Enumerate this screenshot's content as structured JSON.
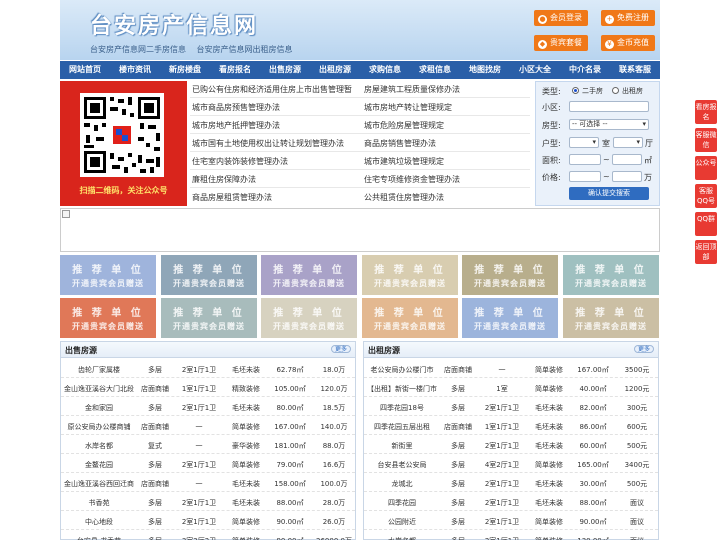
{
  "header": {
    "logo": "台安房产信息网",
    "slogans": [
      "台安房产信息网二手房信息",
      "台安房产信息网出租房信息"
    ],
    "buttons": {
      "login": "会员登录",
      "register": "免费注册",
      "vip": "贵宾套餐",
      "recharge": "金币充值"
    }
  },
  "nav": [
    "网站首页",
    "楼市资讯",
    "新房楼盘",
    "看房报名",
    "出售房源",
    "出租房源",
    "求购信息",
    "求租信息",
    "地图找房",
    "小区大全",
    "中介名录",
    "联系客服"
  ],
  "qr": {
    "caption": "扫描二维码，关注公众号"
  },
  "links_left": [
    "已购公有住房和经济适用住房上市出售管理暂",
    "城市商品房预售管理办法",
    "城市房地产抵押管理办法",
    "城市国有土地使用权出让转让规划管理办法",
    "住宅室内装饰装修管理办法",
    "廉租住房保障办法",
    "商品房屋租赁管理办法"
  ],
  "links_right": [
    "房屋建筑工程质量保修办法",
    "城市房地产转让管理规定",
    "城市危险房屋管理规定",
    "商品房销售管理办法",
    "城市建筑垃圾管理规定",
    "住宅专项维修资金管理办法",
    "公共租赁住房管理办法"
  ],
  "search": {
    "type_label": "类型:",
    "opt_sale": "二手房",
    "opt_rent": "出租房",
    "community_label": "小区:",
    "housetype_label": "房型:",
    "housetype_value": "-- 可选择 --",
    "layout_label": "户型:",
    "room_unit": "室",
    "hall_unit": "厅",
    "area_label": "面积:",
    "area_unit": "㎡",
    "price_label": "价格:",
    "price_unit": "万",
    "range_sep": "~",
    "submit": "确认提交搜索"
  },
  "recommend": {
    "title": "推 荐 单 位",
    "subtitle": "开通贵宾会员赠送",
    "colors": [
      "#9fb4dc",
      "#8fa6b8",
      "#a9a2c8",
      "#d8cdb0",
      "#b8ae8c",
      "#9fc0c0",
      "#e07858",
      "#a8bcbc",
      "#d7d2c0",
      "#e3b890",
      "#9cb4dc",
      "#cbbfa4"
    ]
  },
  "sale": {
    "title": "出售房源",
    "more": "更多",
    "rows": [
      [
        "齿轮厂家属楼",
        "多层",
        "2室1厅1卫",
        "毛坯未装",
        "62.78㎡",
        "18.0万"
      ],
      [
        "金山逸亚溪谷大门北段",
        "店面商铺",
        "1室1厅1卫",
        "精致装修",
        "105.00㎡",
        "120.0万"
      ],
      [
        "金和家园",
        "多层",
        "2室1厅1卫",
        "毛坯未装",
        "80.00㎡",
        "18.5万"
      ],
      [
        "原公安局办公楼商铺",
        "店面商铺",
        "一",
        "简单装修",
        "167.00㎡",
        "140.0万"
      ],
      [
        "水岸名都",
        "复式",
        "一",
        "豪华装修",
        "181.00㎡",
        "88.0万"
      ],
      [
        "金鳌花园",
        "多层",
        "2室1厅1卫",
        "简单装修",
        "79.00㎡",
        "16.6万"
      ],
      [
        "金山逸亚溪谷西回迁商",
        "店面商铺",
        "一",
        "毛坯未装",
        "158.00㎡",
        "100.0万"
      ],
      [
        "书香苑",
        "多层",
        "2室1厅1卫",
        "毛坯未装",
        "88.00㎡",
        "28.0万"
      ],
      [
        "中心地段",
        "多层",
        "2室1厅1卫",
        "简单装修",
        "90.00㎡",
        "26.0万"
      ],
      [
        "台安县 书香苑",
        "多层",
        "3室2厅2卫",
        "简单装修",
        "90.00㎡",
        "26000.0万"
      ]
    ]
  },
  "rent": {
    "title": "出租房源",
    "more": "更多",
    "rows": [
      [
        "老公安局办公楼门市",
        "店面商铺",
        "一",
        "简单装修",
        "167.00㎡",
        "3500元"
      ],
      [
        "【出租】新街一楼门市",
        "多层",
        "1室",
        "简单装修",
        "40.00㎡",
        "1200元"
      ],
      [
        "四季花园18号",
        "多层",
        "2室1厅1卫",
        "毛坯未装",
        "82.00㎡",
        "300元"
      ],
      [
        "四季花园五层出租",
        "店面商铺",
        "1室1厅1卫",
        "毛坯未装",
        "86.00㎡",
        "600元"
      ],
      [
        "新街里",
        "多层",
        "2室1厅1卫",
        "毛坯未装",
        "60.00㎡",
        "500元"
      ],
      [
        "台安县老公安局",
        "多层",
        "4室2厅1卫",
        "简单装修",
        "165.00㎡",
        "3400元"
      ],
      [
        "龙城北",
        "多层",
        "2室1厅1卫",
        "毛坯未装",
        "30.00㎡",
        "500元"
      ],
      [
        "四季花园",
        "多层",
        "2室1厅1卫",
        "毛坯未装",
        "88.00㎡",
        "面议"
      ],
      [
        "公园附近",
        "多层",
        "2室1厅1卫",
        "简单装修",
        "90.00㎡",
        "面议"
      ],
      [
        "水岸名都",
        "多层",
        "2室1厅1卫",
        "简单装修",
        "130.00㎡",
        "面议"
      ]
    ]
  },
  "float": [
    "看房报名",
    "客服微信",
    "公众号",
    "客服QQ号",
    "QQ群",
    "返回顶部"
  ]
}
